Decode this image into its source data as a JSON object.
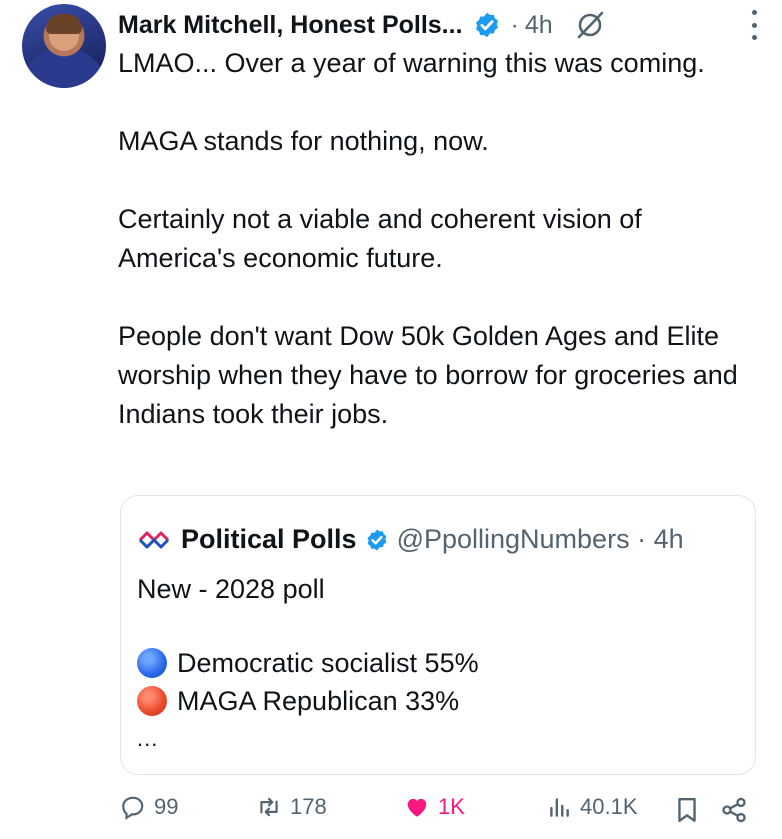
{
  "tweet": {
    "author_name": "Mark Mitchell, Honest Polls...",
    "separator": "·",
    "time": "4h",
    "body": [
      "LMAO... Over a year of warning this was coming.",
      "MAGA stands for nothing, now.",
      "Certainly not a viable and coherent vision of America's economic future.",
      "People don't want Dow 50k Golden Ages and Elite worship when they have to borrow for groceries and Indians took their jobs."
    ]
  },
  "quote": {
    "author_name": "Political Polls",
    "handle_time": "@PpollingNumbers · 4h",
    "text": "New - 2028 poll",
    "items": [
      {
        "color": "blue",
        "text": "Democratic socialist 55%"
      },
      {
        "color": "red",
        "text": "MAGA Republican 33%"
      }
    ],
    "more": "..."
  },
  "actions": {
    "replies": "99",
    "reposts": "178",
    "likes": "1K",
    "views": "40.1K"
  },
  "icons": {
    "verified": "verified-badge-icon",
    "grok": "grok-icon",
    "more": "more-options-icon",
    "reply": "reply-icon",
    "repost": "repost-icon",
    "like": "heart-icon",
    "views": "views-icon",
    "bookmark": "bookmark-icon",
    "share": "share-icon"
  },
  "colors": {
    "verified": "#1d9bf0",
    "like": "#f91880",
    "secondary_text": "#536471"
  }
}
